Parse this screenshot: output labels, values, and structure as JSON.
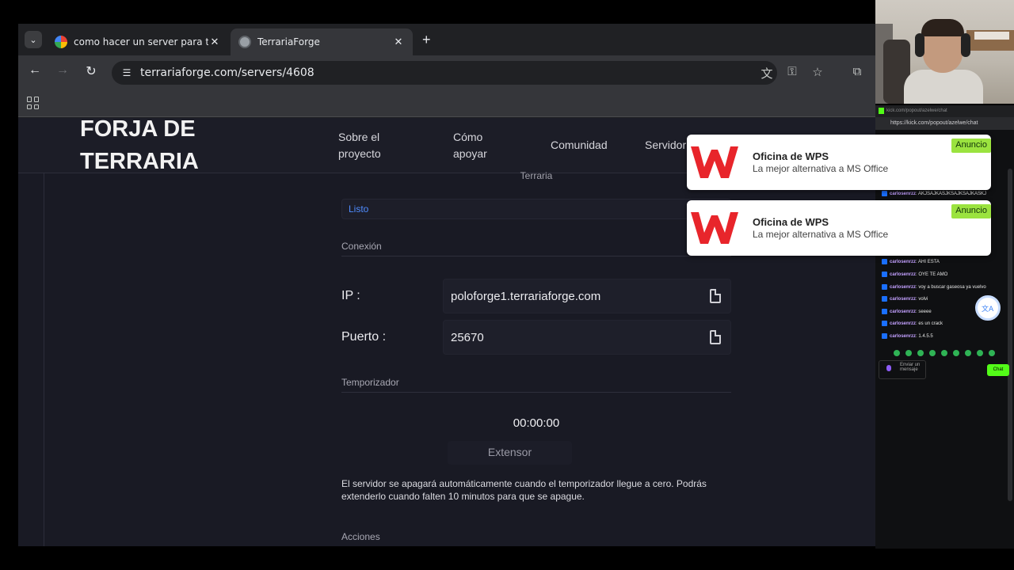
{
  "browser": {
    "tabs": [
      {
        "title": "como hacer un server para terra",
        "active": false
      },
      {
        "title": "TerrariaForge",
        "active": true
      }
    ],
    "url": "terrariaforge.com/servers/4608"
  },
  "site": {
    "brand_line1": "FORJA DE",
    "brand_line2": "TERRARIA",
    "nav": [
      {
        "l1": "Sobre el",
        "l2": "proyecto"
      },
      {
        "l1": "Cómo",
        "l2": "apoyar"
      },
      {
        "l1": "Comunidad",
        "l2": ""
      },
      {
        "l1": "Servidor",
        "l2": ""
      }
    ]
  },
  "server": {
    "game_label": "Terraria",
    "status": "Listo",
    "connection_title": "Conexión",
    "ip_label": "IP :",
    "ip_value": "poloforge1.terrariaforge.com",
    "port_label": "Puerto :",
    "port_value": "25670",
    "timer_title": "Temporizador",
    "timer_value": "00:00:00",
    "extend_label": "Extensor",
    "timer_note": "El servidor se apagará automáticamente cuando el temporizador llegue a cero. Podrás extenderlo cuando falten 10 minutos para que se apague.",
    "actions_title": "Acciones"
  },
  "ads": [
    {
      "title": "Oficina de WPS",
      "subtitle": "La mejor alternativa a MS Office",
      "badge": "Anuncio"
    },
    {
      "title": "Oficina de WPS",
      "subtitle": "La mejor alternativa a MS Office",
      "badge": "Anuncio"
    }
  ],
  "chat": {
    "window_title": "kick.com/popout/azelwe/chat",
    "url": "https://kick.com/popout/azelwe/chat",
    "messages": [
      {
        "user": "carlosenrzz",
        "text": ": AKJSAJKASJKSAJKSAJKASKJ"
      },
      {
        "user": "carlosenrzz",
        "text": ": AHI ESTA"
      },
      {
        "user": "carlosenrzz",
        "text": ": OYE TE AMO"
      },
      {
        "user": "carlosenrzz",
        "text": ": voy a buscar gaseosa ya vuelvo"
      },
      {
        "user": "carlosenrzz",
        "text": ": volvi"
      },
      {
        "user": "carlosenrzz",
        "text": ": seeee"
      },
      {
        "user": "carlosenrzz",
        "text": ": es un crack"
      },
      {
        "user": "carlosenrzz",
        "text": ": 1.4.5.5"
      }
    ],
    "input_placeholder": "Enviar un mensaje",
    "send_label": "Chat"
  },
  "colors": {
    "accent_link": "#4f8cff",
    "kick_green": "#53fc18",
    "ad_badge": "#9be33f"
  }
}
